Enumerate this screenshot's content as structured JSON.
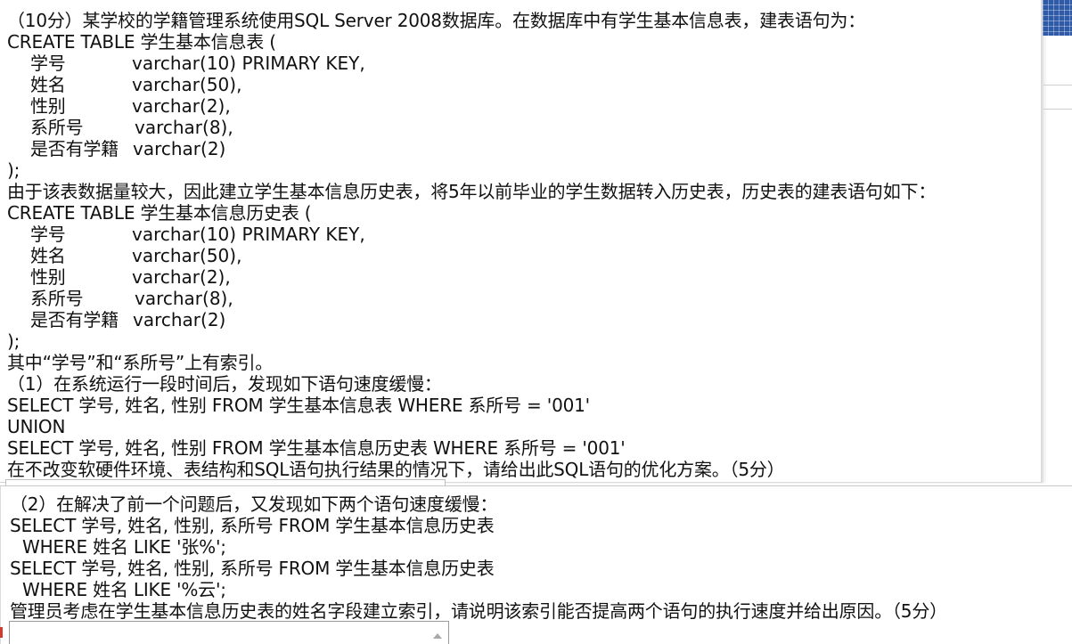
{
  "question": {
    "intro": "（10分）某学校的学籍管理系统使用SQL Server 2008数据库。在数据库中有学生基本信息表，建表语句为：",
    "table1_header": "CREATE TABLE 学生基本信息表 (",
    "columns": [
      {
        "name": "学号",
        "type": "varchar(10) PRIMARY KEY,"
      },
      {
        "name": "姓名",
        "type": "varchar(50),"
      },
      {
        "name": "性别",
        "type": "varchar(2),"
      },
      {
        "name": "系所号",
        "type": "varchar(8),"
      },
      {
        "name": "是否有学籍",
        "type": "varchar(2)"
      }
    ],
    "close_paren": ");",
    "history_intro": "由于该表数据量较大，因此建立学生基本信息历史表，将5年以前毕业的学生数据转入历史表，历史表的建表语句如下：",
    "table2_header": "CREATE TABLE 学生基本信息历史表 (",
    "index_note": "其中“学号”和“系所号”上有索引。",
    "part1": {
      "prompt": "（1）在系统运行一段时间后，发现如下语句速度缓慢：",
      "sql_line1": "SELECT 学号, 姓名, 性别 FROM 学生基本信息表 WHERE 系所号 = '001'",
      "sql_line2": "UNION",
      "sql_line3": "SELECT 学号, 姓名, 性别 FROM 学生基本信息历史表 WHERE 系所号 = '001'",
      "task": "在不改变软硬件环境、表结构和SQL语句执行结果的情况下，请给出此SQL语句的优化方案。（5分）"
    },
    "part2": {
      "prompt": "（2）在解决了前一个问题后，又发现如下两个语句速度缓慢：",
      "sql1_line1": "SELECT 学号, 姓名, 性别, 系所号 FROM 学生基本信息历史表",
      "sql1_line2": "WHERE 姓名 LIKE '张%';",
      "sql2_line1": "SELECT 学号, 姓名, 性别, 系所号 FROM 学生基本信息历史表",
      "sql2_line2": "WHERE 姓名 LIKE '%云';",
      "task": "管理员考虑在学生基本信息历史表的姓名字段建立索引，请说明该索引能否提高两个语句的执行速度并给出原因。（5分）"
    }
  },
  "colors": {
    "text": "#111111",
    "accent_block": "#2f5aa8",
    "marker": "#d23a2e"
  }
}
